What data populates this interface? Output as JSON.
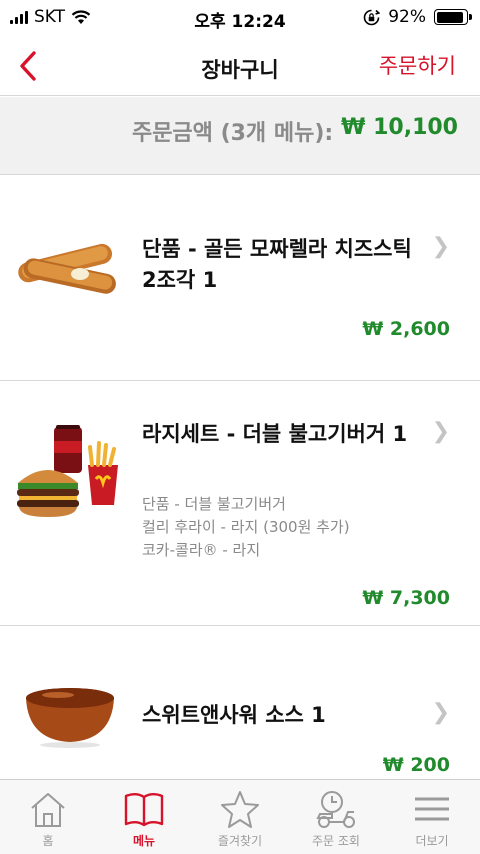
{
  "status_bar": {
    "carrier": "SKT",
    "time": "오후 12:24",
    "battery": "92%",
    "battery_level": 0.92
  },
  "nav": {
    "title": "장바구니",
    "order_label": "주문하기",
    "back_icon": "chevron-left-icon"
  },
  "summary": {
    "label": "주문금액 (3개 메뉴):",
    "total": "₩ 10,100"
  },
  "items": [
    {
      "name": "단품 - 골든 모짜렐라 치즈스틱 2조각 1",
      "options": [],
      "price": "₩ 2,600",
      "image": "cheese-sticks-image"
    },
    {
      "name": "라지세트 - 더블 불고기버거 1",
      "options": [
        "단품 - 더블 불고기버거",
        "컬리 후라이 - 라지 (300원 추가)",
        "코카-콜라® - 라지"
      ],
      "price": "₩ 7,300",
      "image": "burger-set-image"
    },
    {
      "name": "스위트앤사워 소스 1",
      "options": [],
      "price": "₩ 200",
      "image": "sauce-image"
    }
  ],
  "tabs": [
    {
      "label": "홈",
      "icon": "home-icon",
      "active": false
    },
    {
      "label": "메뉴",
      "icon": "menu-book-icon",
      "active": true
    },
    {
      "label": "즐겨찾기",
      "icon": "star-icon",
      "active": false
    },
    {
      "label": "주문 조회",
      "icon": "delivery-scooter-icon",
      "active": false
    },
    {
      "label": "더보기",
      "icon": "hamburger-menu-icon",
      "active": false
    }
  ],
  "colors": {
    "brand_red": "#d7132b",
    "price_green": "#208a2c",
    "muted_gray": "#8a8a8a"
  }
}
